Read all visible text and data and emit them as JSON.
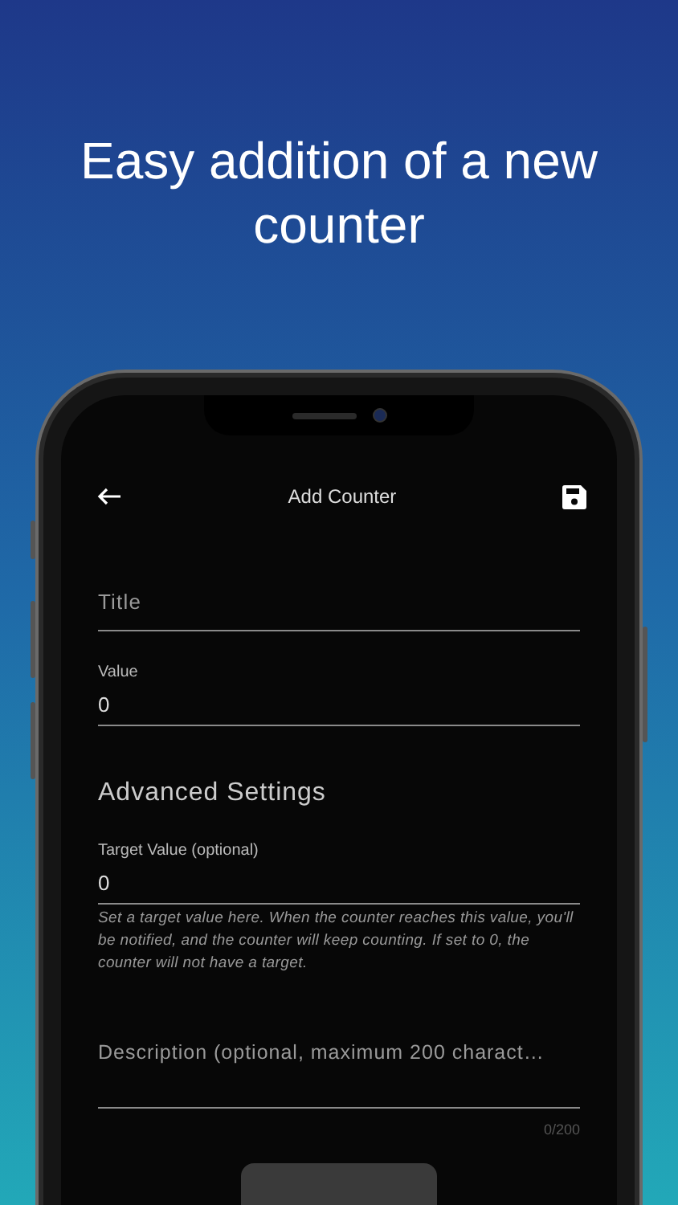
{
  "headline": "Easy addition of a new counter",
  "app_bar": {
    "title": "Add Counter"
  },
  "fields": [
    {
      "kind": "plain",
      "placeholder": "Title"
    },
    {
      "kind": "labeled",
      "label": "Value",
      "value": "0"
    }
  ],
  "section_title": "Advanced Settings",
  "target_field": {
    "label": "Target Value (optional)",
    "value": "0",
    "helper": "Set a target value here. When the counter reaches this value, you'll be notified, and the counter will keep counting. If set to 0, the counter will not have a target."
  },
  "description_field": {
    "placeholder": "Description (optional, maximum 200 charact…",
    "counter": "0/200"
  }
}
